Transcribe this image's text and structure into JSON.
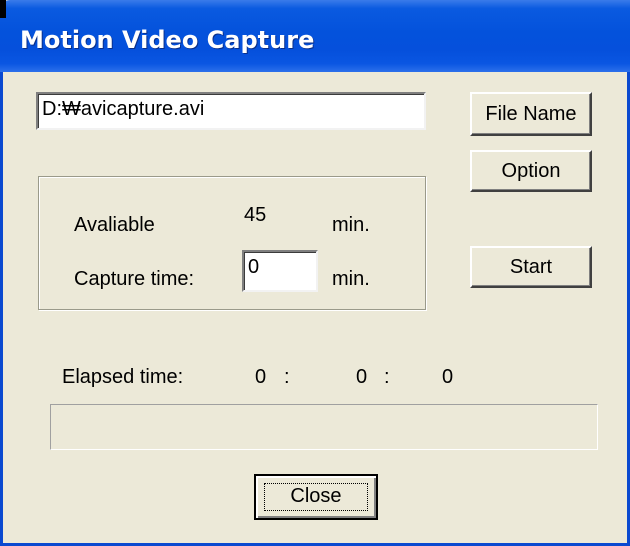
{
  "window": {
    "title": "Motion Video Capture"
  },
  "file": {
    "path_value": "D:₩avicapture.avi",
    "file_name_button": "File Name",
    "option_button": "Option"
  },
  "capture": {
    "available_label": "Avaliable",
    "available_value": "45",
    "available_unit": "min.",
    "capture_time_label": "Capture time:",
    "capture_time_value": "0",
    "capture_time_unit": "min.",
    "start_button": "Start"
  },
  "elapsed": {
    "label": "Elapsed time:",
    "hours": "0",
    "sep1": ":",
    "minutes": "0",
    "sep2": ":",
    "seconds": "0",
    "progress_fraction": 0
  },
  "footer": {
    "close_button": "Close"
  },
  "colors": {
    "titlebar": "#0452dc",
    "dialog_bg": "#ece9d8",
    "title_text": "#ffffff"
  }
}
